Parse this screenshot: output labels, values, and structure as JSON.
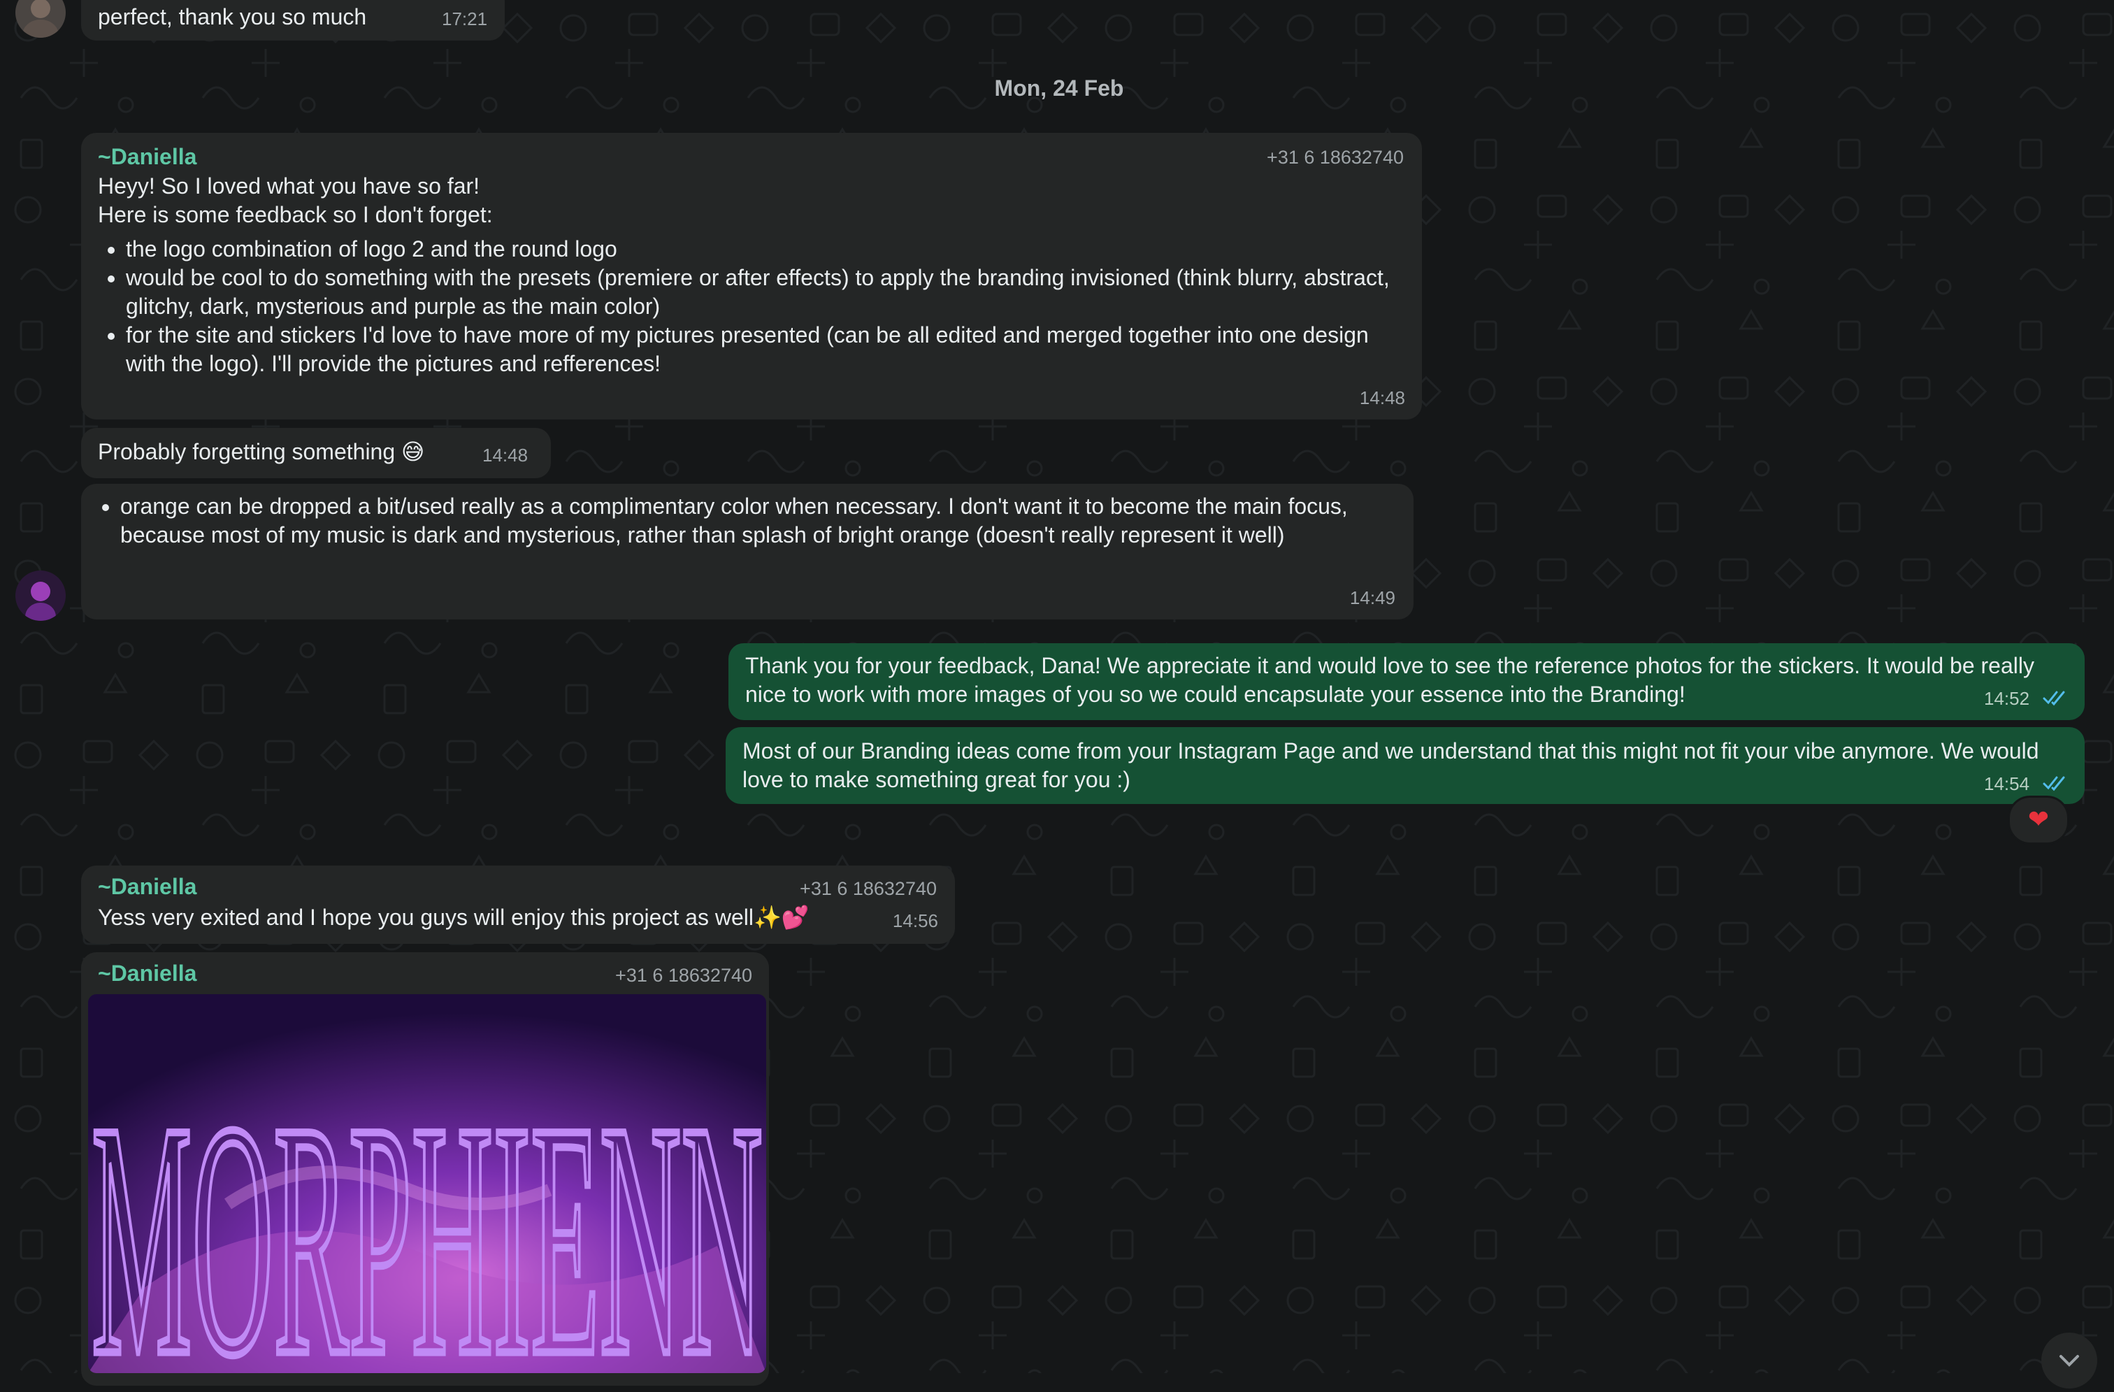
{
  "date_separator": "Mon, 24 Feb",
  "messages": {
    "m0": {
      "text": "perfect, thank you so much",
      "time": "17:21"
    },
    "m1": {
      "sender": "~Daniella",
      "phone": "+31 6 18632740",
      "lines": [
        "Heyy! So I loved what you have so far!",
        "Here is some feedback so I don't forget:"
      ],
      "bullets": [
        "the logo combination of logo 2 and the round logo",
        "would be cool to do something with the presets (premiere or after effects) to apply the branding invisioned (think blurry, abstract, glitchy, dark, mysterious and purple as the main color)",
        "for the site and stickers I'd love to have more of my pictures presented (can be all edited and merged together into one design with the logo). I'll provide the pictures and refferences!"
      ],
      "time": "14:48"
    },
    "m2": {
      "text": "Probably forgetting something 😅",
      "time": "14:48"
    },
    "m3": {
      "bullets": [
        "orange can be dropped a bit/used really as a complimentary color when necessary. I don't want it to become the main focus, because most of my music is dark and mysterious, rather than splash of bright orange (doesn't really represent it well)"
      ],
      "time": "14:49"
    },
    "m4": {
      "text": "Thank you for your feedback, Dana! We appreciate it and would love to see the reference photos for the stickers. It would be really nice to work with more images of you so we could encapsulate your essence into the Branding!",
      "time": "14:52"
    },
    "m5": {
      "text": "Most of our Branding ideas come from your Instagram Page and we understand that this might not fit your vibe anymore. We would love to make something great for you :)",
      "time": "14:54",
      "reaction": "❤"
    },
    "m6": {
      "sender": "~Daniella",
      "phone": "+31 6 18632740",
      "text": "Yess very exited and I hope you guys will enjoy this project as well✨💕",
      "time": "14:56"
    },
    "m7": {
      "sender": "~Daniella",
      "phone": "+31 6 18632740",
      "image_text": "MORPHIENN"
    }
  },
  "colors": {
    "outgoing_bubble": "#155134",
    "incoming_bubble": "#242626",
    "sender_name": "#5ec7a5",
    "read_check": "#53bdeb"
  },
  "icons": {
    "read_receipt": "double-check-icon",
    "scroll_down": "chevron-down-icon",
    "reaction": "heart-icon"
  }
}
